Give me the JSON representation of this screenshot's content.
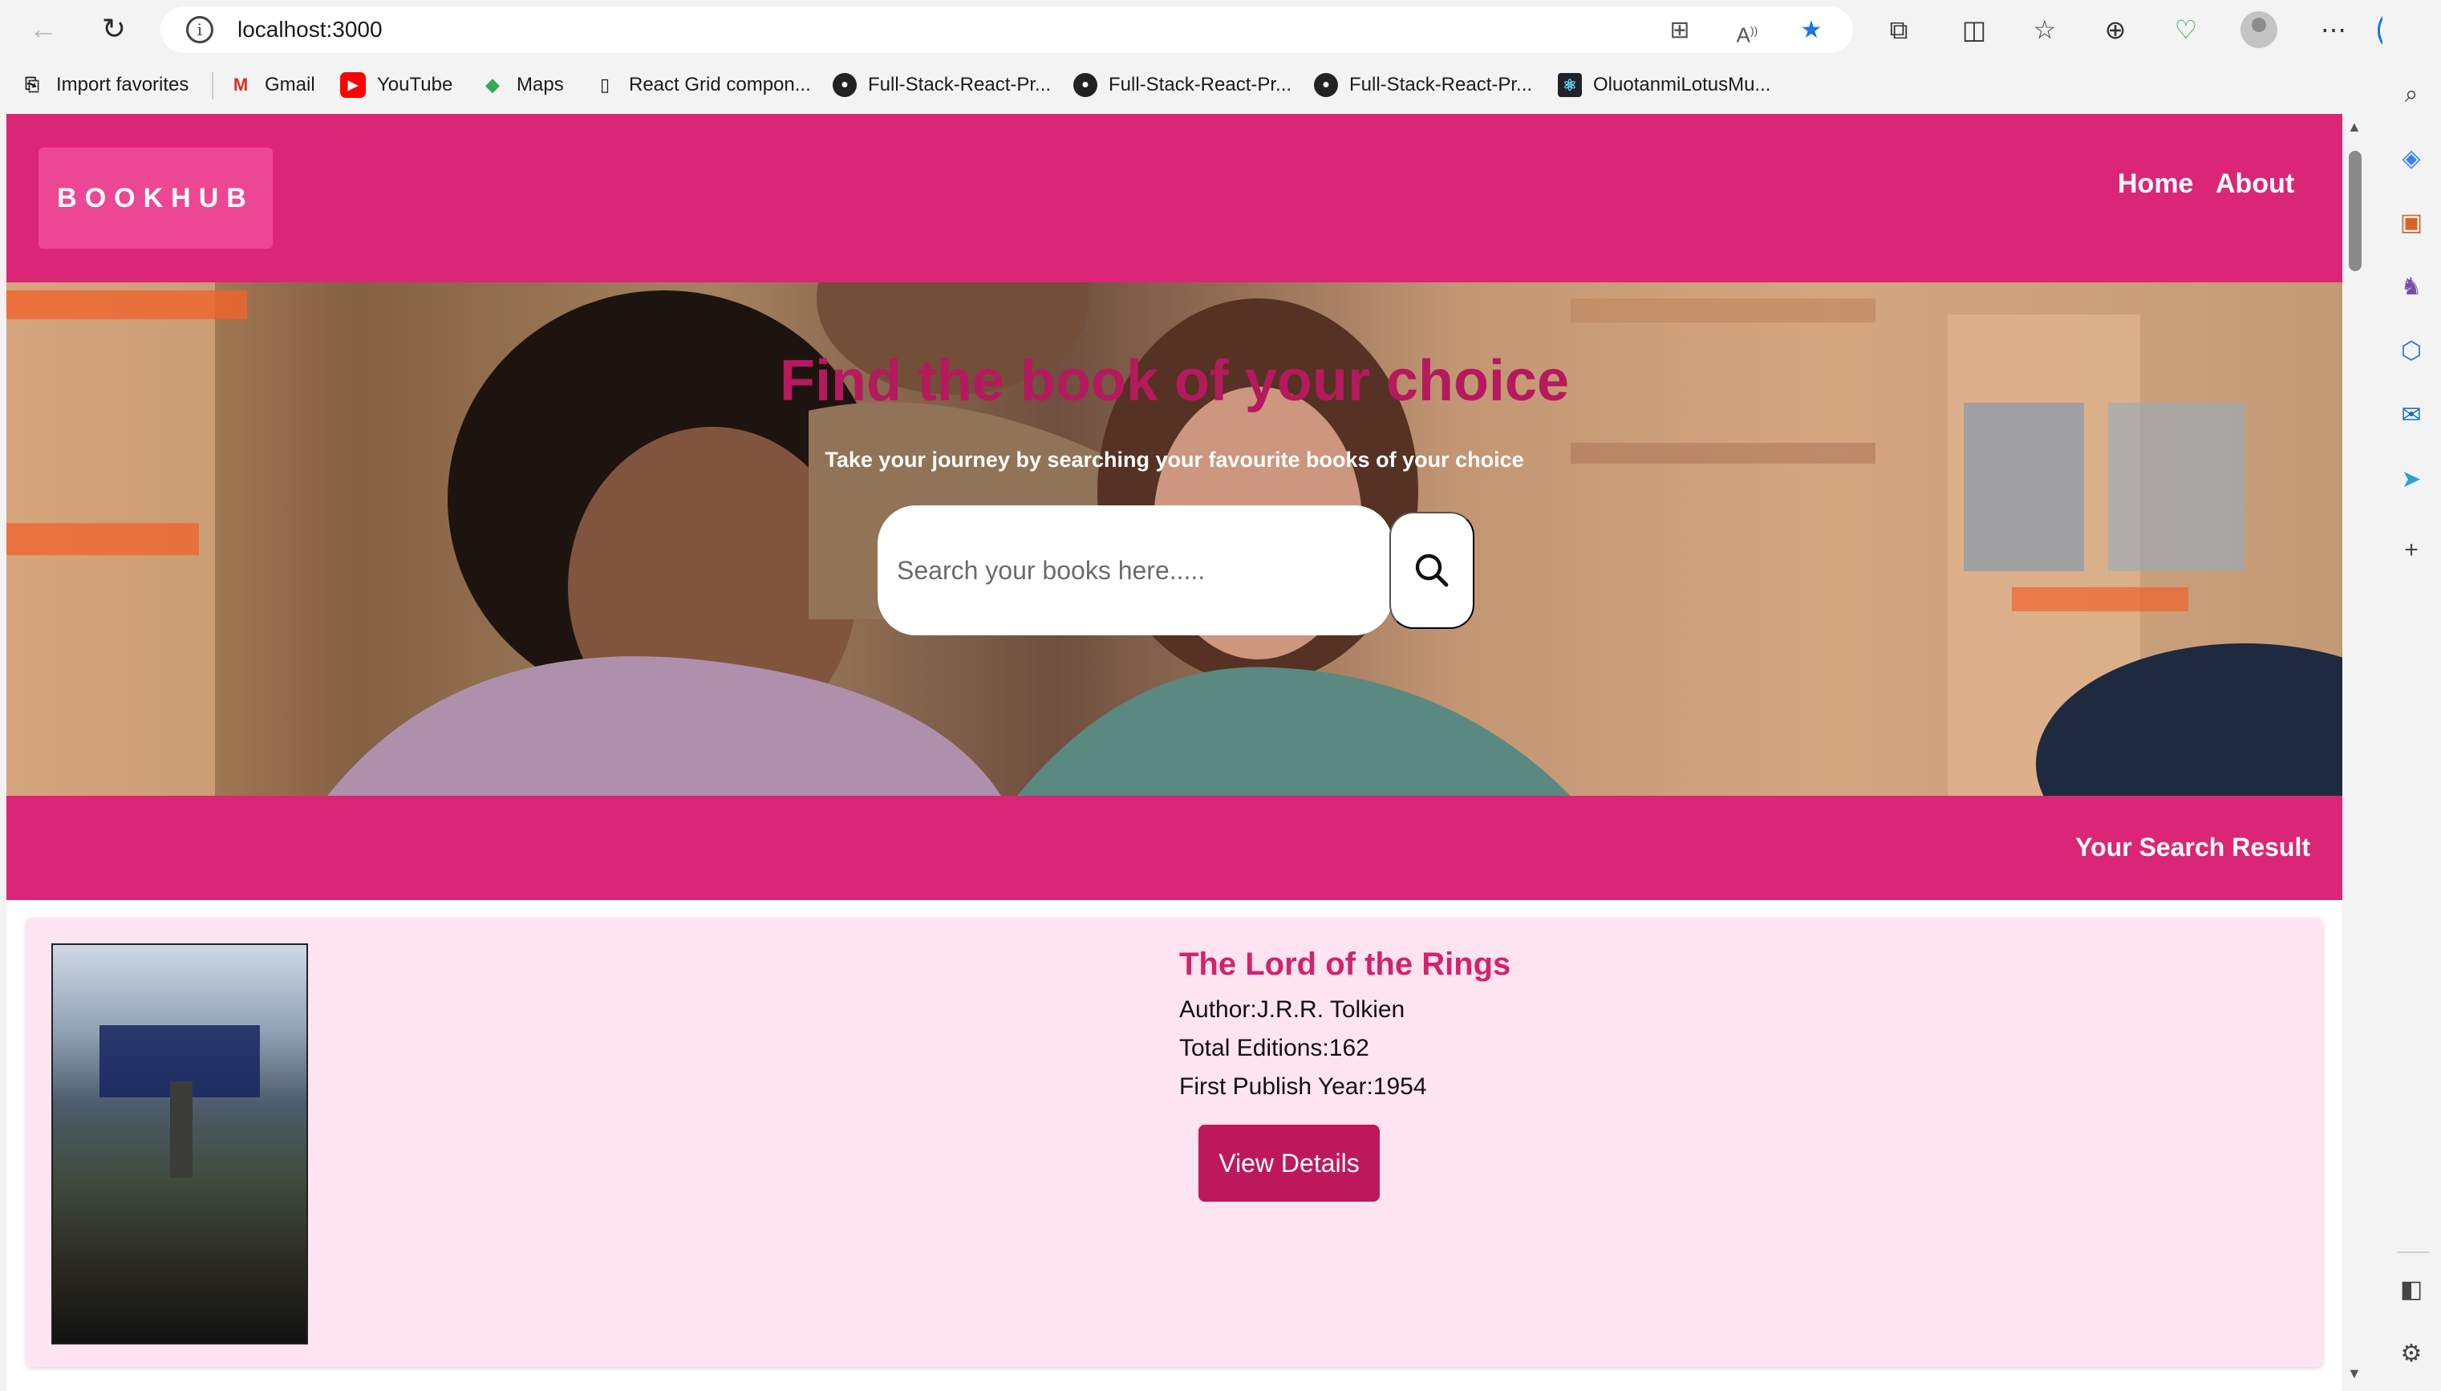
{
  "browser": {
    "url": "localhost:3000",
    "bookmarks": [
      {
        "label": "Import favorites",
        "icon": "import-icon"
      },
      {
        "label": "Gmail",
        "icon": "gmail-icon"
      },
      {
        "label": "YouTube",
        "icon": "youtube-icon"
      },
      {
        "label": "Maps",
        "icon": "maps-icon"
      },
      {
        "label": "React Grid compon...",
        "icon": "page-icon"
      },
      {
        "label": "Full-Stack-React-Pr...",
        "icon": "github-icon"
      },
      {
        "label": "Full-Stack-React-Pr...",
        "icon": "github-icon"
      },
      {
        "label": "Full-Stack-React-Pr...",
        "icon": "github-icon"
      },
      {
        "label": "OluotanmiLotusMu...",
        "icon": "react-icon"
      }
    ]
  },
  "site": {
    "logo": "BOOKHUB",
    "nav": {
      "home": "Home",
      "about": "About"
    }
  },
  "hero": {
    "title": "Find the book of your choice",
    "subtitle": "Take your journey by searching your favourite books of your choice",
    "search_placeholder": "Search your books here....."
  },
  "results": {
    "heading": "Your Search Result",
    "books": [
      {
        "title": "The Lord of the Rings",
        "author": "Author:J.R.R. Tolkien",
        "editions": "Total Editions:162",
        "first_publish": "First Publish Year:1954",
        "button": "View Details"
      }
    ]
  },
  "colors": {
    "brand_pink": "#db2677",
    "logo_pink": "#ec4795",
    "title_magenta": "#b5195e",
    "card_bg": "#fde4f0",
    "button": "#be185d"
  }
}
